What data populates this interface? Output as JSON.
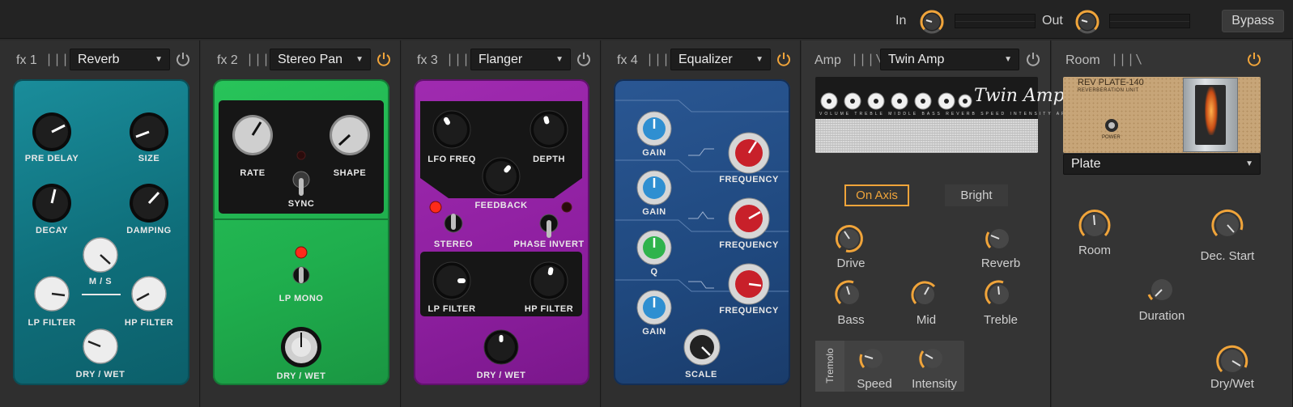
{
  "topbar": {
    "in_label": "In",
    "out_label": "Out",
    "bypass_label": "Bypass"
  },
  "slots": [
    {
      "label": "fx 1",
      "bars": "|||\\",
      "preset": "Reverb",
      "power_on": false
    },
    {
      "label": "fx 2",
      "bars": "|||\\",
      "preset": "Stereo Pan",
      "power_on": true
    },
    {
      "label": "fx 3",
      "bars": "|||\\",
      "preset": "Flanger",
      "power_on": false
    },
    {
      "label": "fx 4",
      "bars": "|||\\",
      "preset": "Equalizer",
      "power_on": true
    },
    {
      "label": "Amp",
      "bars": "|||\\",
      "preset": "Twin Amp",
      "power_on": false
    },
    {
      "label": "Room",
      "bars": "|||\\",
      "power_on": true
    }
  ],
  "reverb": {
    "pre_delay": "PRE DELAY",
    "size": "SIZE",
    "decay": "DECAY",
    "damping": "DAMPING",
    "ms": "M / S",
    "lp_filter": "LP FILTER",
    "hp_filter": "HP FILTER",
    "dry_wet": "DRY / WET"
  },
  "stereo_pan": {
    "rate": "RATE",
    "shape": "SHAPE",
    "sync": "SYNC",
    "lp_mono": "LP MONO",
    "dry_wet": "DRY / WET"
  },
  "flanger": {
    "lfo_freq": "LFO FREQ",
    "depth": "DEPTH",
    "feedback": "FEEDBACK",
    "stereo": "STEREO",
    "phase_invert": "PHASE INVERT",
    "lp_filter": "LP FILTER",
    "hp_filter": "HP FILTER",
    "dry_wet": "DRY / WET"
  },
  "equalizer": {
    "gain_1": "GAIN",
    "gain_2": "GAIN",
    "q": "Q",
    "gain_3": "GAIN",
    "frequency_1": "FREQUENCY",
    "frequency_2": "FREQUENCY",
    "frequency_3": "FREQUENCY",
    "scale": "SCALE"
  },
  "amp": {
    "brand": "Twin Amp",
    "panel_labels": "VOLUME TREBLE MIDDLE BASS REVERB SPEED INTENSITY ARTURIA MUSICAL INSTRUMENTS",
    "on_axis": "On Axis",
    "bright": "Bright",
    "drive": "Drive",
    "reverb": "Reverb",
    "bass": "Bass",
    "mid": "Mid",
    "treble": "Treble",
    "tremolo": "Tremolo",
    "speed": "Speed",
    "intensity": "Intensity"
  },
  "room": {
    "plate_title": "REV PLATE-140",
    "plate_subtitle": "REVERBERATION UNIT",
    "plate_power": "POWER",
    "type": "Plate",
    "room": "Room",
    "dec_start": "Dec. Start",
    "duration": "Duration",
    "dry_wet": "Dry/Wet"
  },
  "colors": {
    "accent": "#f0a43a",
    "teal_pedal": "#0f6f7b",
    "green_pedal": "#1fae4d",
    "purple_pedal": "#8e1fa0",
    "blue_pedal": "#1f487e"
  }
}
